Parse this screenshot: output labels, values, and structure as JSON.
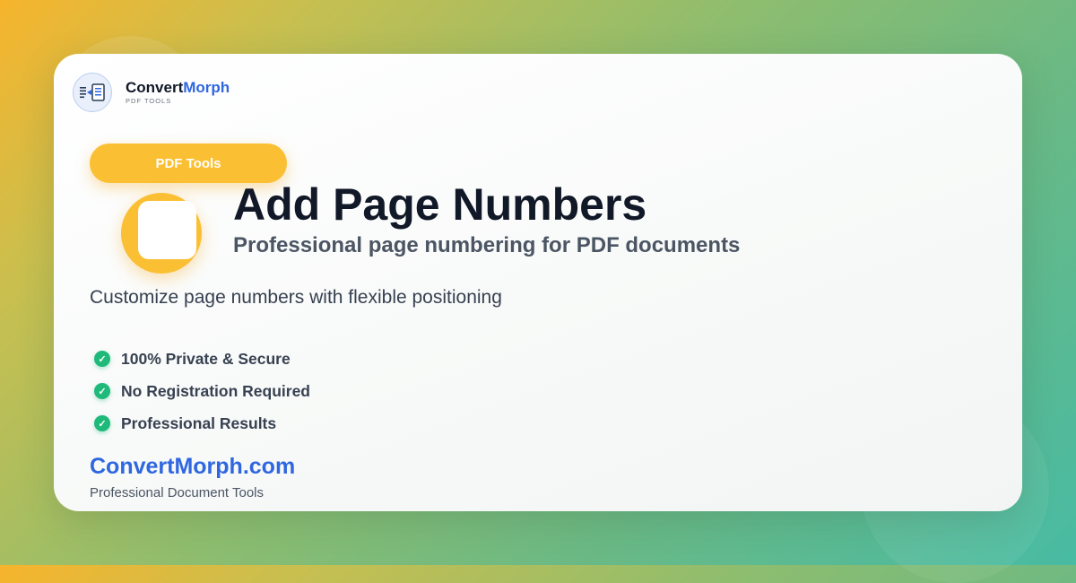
{
  "brand": {
    "name_primary": "Convert",
    "name_accent": "Morph",
    "subtitle": "PDF TOOLS",
    "logo_icon": "document-convert-icon"
  },
  "category_pill": {
    "label": "PDF Tools"
  },
  "tool": {
    "icon": "page-number-icon",
    "title": "Add Page Numbers",
    "subtitle": "Professional page numbering for PDF documents",
    "description": "Customize page numbers with flexible positioning"
  },
  "features": [
    {
      "label": "100% Private & Secure",
      "icon": "check-circle-icon"
    },
    {
      "label": "No Registration Required",
      "icon": "check-circle-icon"
    },
    {
      "label": "Professional Results",
      "icon": "check-circle-icon"
    }
  ],
  "footer": {
    "site": "ConvertMorph.com",
    "tagline": "Professional Document Tools"
  },
  "colors": {
    "accent_blue": "#2f67e0",
    "accent_yellow": "#fbbf33",
    "check_green": "#1fb97a",
    "text_dark": "#111827"
  }
}
